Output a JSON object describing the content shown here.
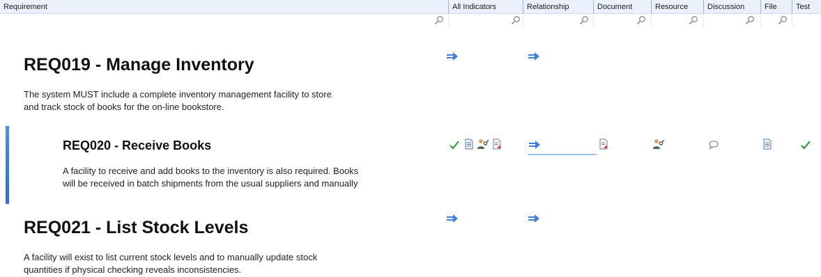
{
  "columns": {
    "requirement": "Requirement",
    "all_indicators": "All Indicators",
    "relationship": "Relationship",
    "document": "Document",
    "resource": "Resource",
    "discussion": "Discussion",
    "file": "File",
    "test": "Test"
  },
  "requirements": [
    {
      "title": "REQ019 - Manage Inventory",
      "description_lines": [
        "The system MUST include a complete inventory management facility to store",
        "and track stock of books for the on-line bookstore."
      ]
    },
    {
      "title": "REQ020 - Receive Books",
      "description_lines": [
        "A facility to receive and add books to the inventory is also required. Books",
        "will be received in batch shipments from the usual suppliers and manually"
      ]
    },
    {
      "title": "REQ021 - List Stock Levels",
      "description_lines": [
        "A facility will exist to list current stock levels and to manually update stock",
        "quantities if physical checking reveals inconsistencies."
      ]
    }
  ],
  "colors": {
    "header_bg": "#eaf1fb",
    "selection_bar": "#2c6fd0",
    "arrow": "#3d7fe0",
    "check": "#2e9a3a"
  },
  "icons": [
    "search-icon",
    "arrow-right-icon",
    "check-icon",
    "document-icon",
    "resource-icon",
    "file-icon",
    "discussion-icon"
  ]
}
